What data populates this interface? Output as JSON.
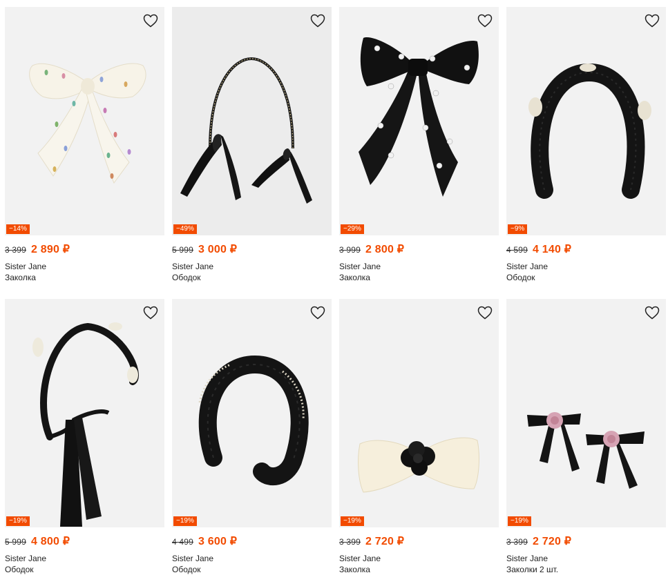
{
  "colors": {
    "accent": "#f24b00",
    "card_bg": "#f2f2f2"
  },
  "products": [
    {
      "discount": "−14%",
      "old_price": "3 399",
      "price": "2 890 ₽",
      "brand": "Sister Jane",
      "type": "Заколка",
      "image": "white-bow-with-jewels"
    },
    {
      "discount": "−49%",
      "old_price": "5 999",
      "price": "3 000 ₽",
      "brand": "Sister Jane",
      "type": "Ободок",
      "image": "thin-headband-with-black-ribbons"
    },
    {
      "discount": "−29%",
      "old_price": "3 999",
      "price": "2 800 ₽",
      "brand": "Sister Jane",
      "type": "Заколка",
      "image": "black-bow-with-pearl-flowers"
    },
    {
      "discount": "−9%",
      "old_price": "4 599",
      "price": "4 140 ₽",
      "brand": "Sister Jane",
      "type": "Ободок",
      "image": "black-padded-headband-with-lace"
    },
    {
      "discount": "−19%",
      "old_price": "5 999",
      "price": "4 800 ₽",
      "brand": "Sister Jane",
      "type": "Ободок",
      "image": "headband-with-long-black-ties"
    },
    {
      "discount": "−19%",
      "old_price": "4 499",
      "price": "3 600 ₽",
      "brand": "Sister Jane",
      "type": "Ободок",
      "image": "black-padded-headband-with-pearls"
    },
    {
      "discount": "−19%",
      "old_price": "3 399",
      "price": "2 720 ₽",
      "brand": "Sister Jane",
      "type": "Заколка",
      "image": "cream-bow-with-black-flower"
    },
    {
      "discount": "−19%",
      "old_price": "3 399",
      "price": "2 720 ₽",
      "brand": "Sister Jane",
      "type": "Заколки 2 шт.",
      "image": "two-black-bows-with-pink-roses"
    }
  ]
}
